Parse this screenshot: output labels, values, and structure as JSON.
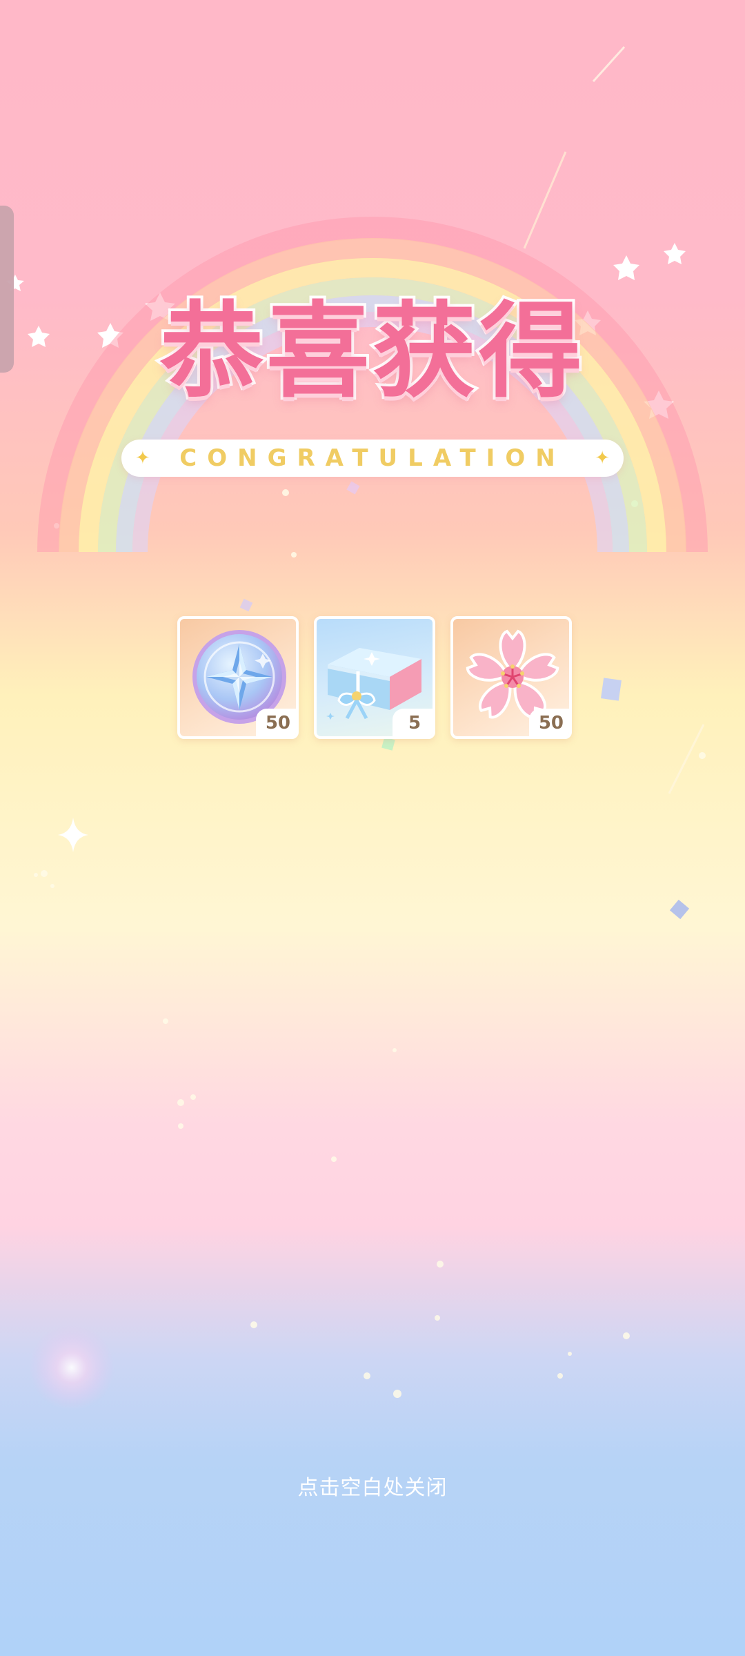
{
  "title": "恭喜获得",
  "subtitle": "CONGRATULATION",
  "rewards": [
    {
      "name": "compass-medal",
      "quantity": "50",
      "icon": "compass-star-coin-icon",
      "card_style": "orange"
    },
    {
      "name": "gift-box",
      "quantity": "5",
      "icon": "gift-box-icon",
      "card_style": "blue"
    },
    {
      "name": "sakura-flower",
      "quantity": "50",
      "icon": "sakura-flower-icon",
      "card_style": "orange"
    }
  ],
  "close_hint": "点击空白处关闭",
  "colors": {
    "title_pink": "#f36f98",
    "subtitle_gold": "#f0cc63",
    "quantity_brown": "#8a6e52"
  }
}
